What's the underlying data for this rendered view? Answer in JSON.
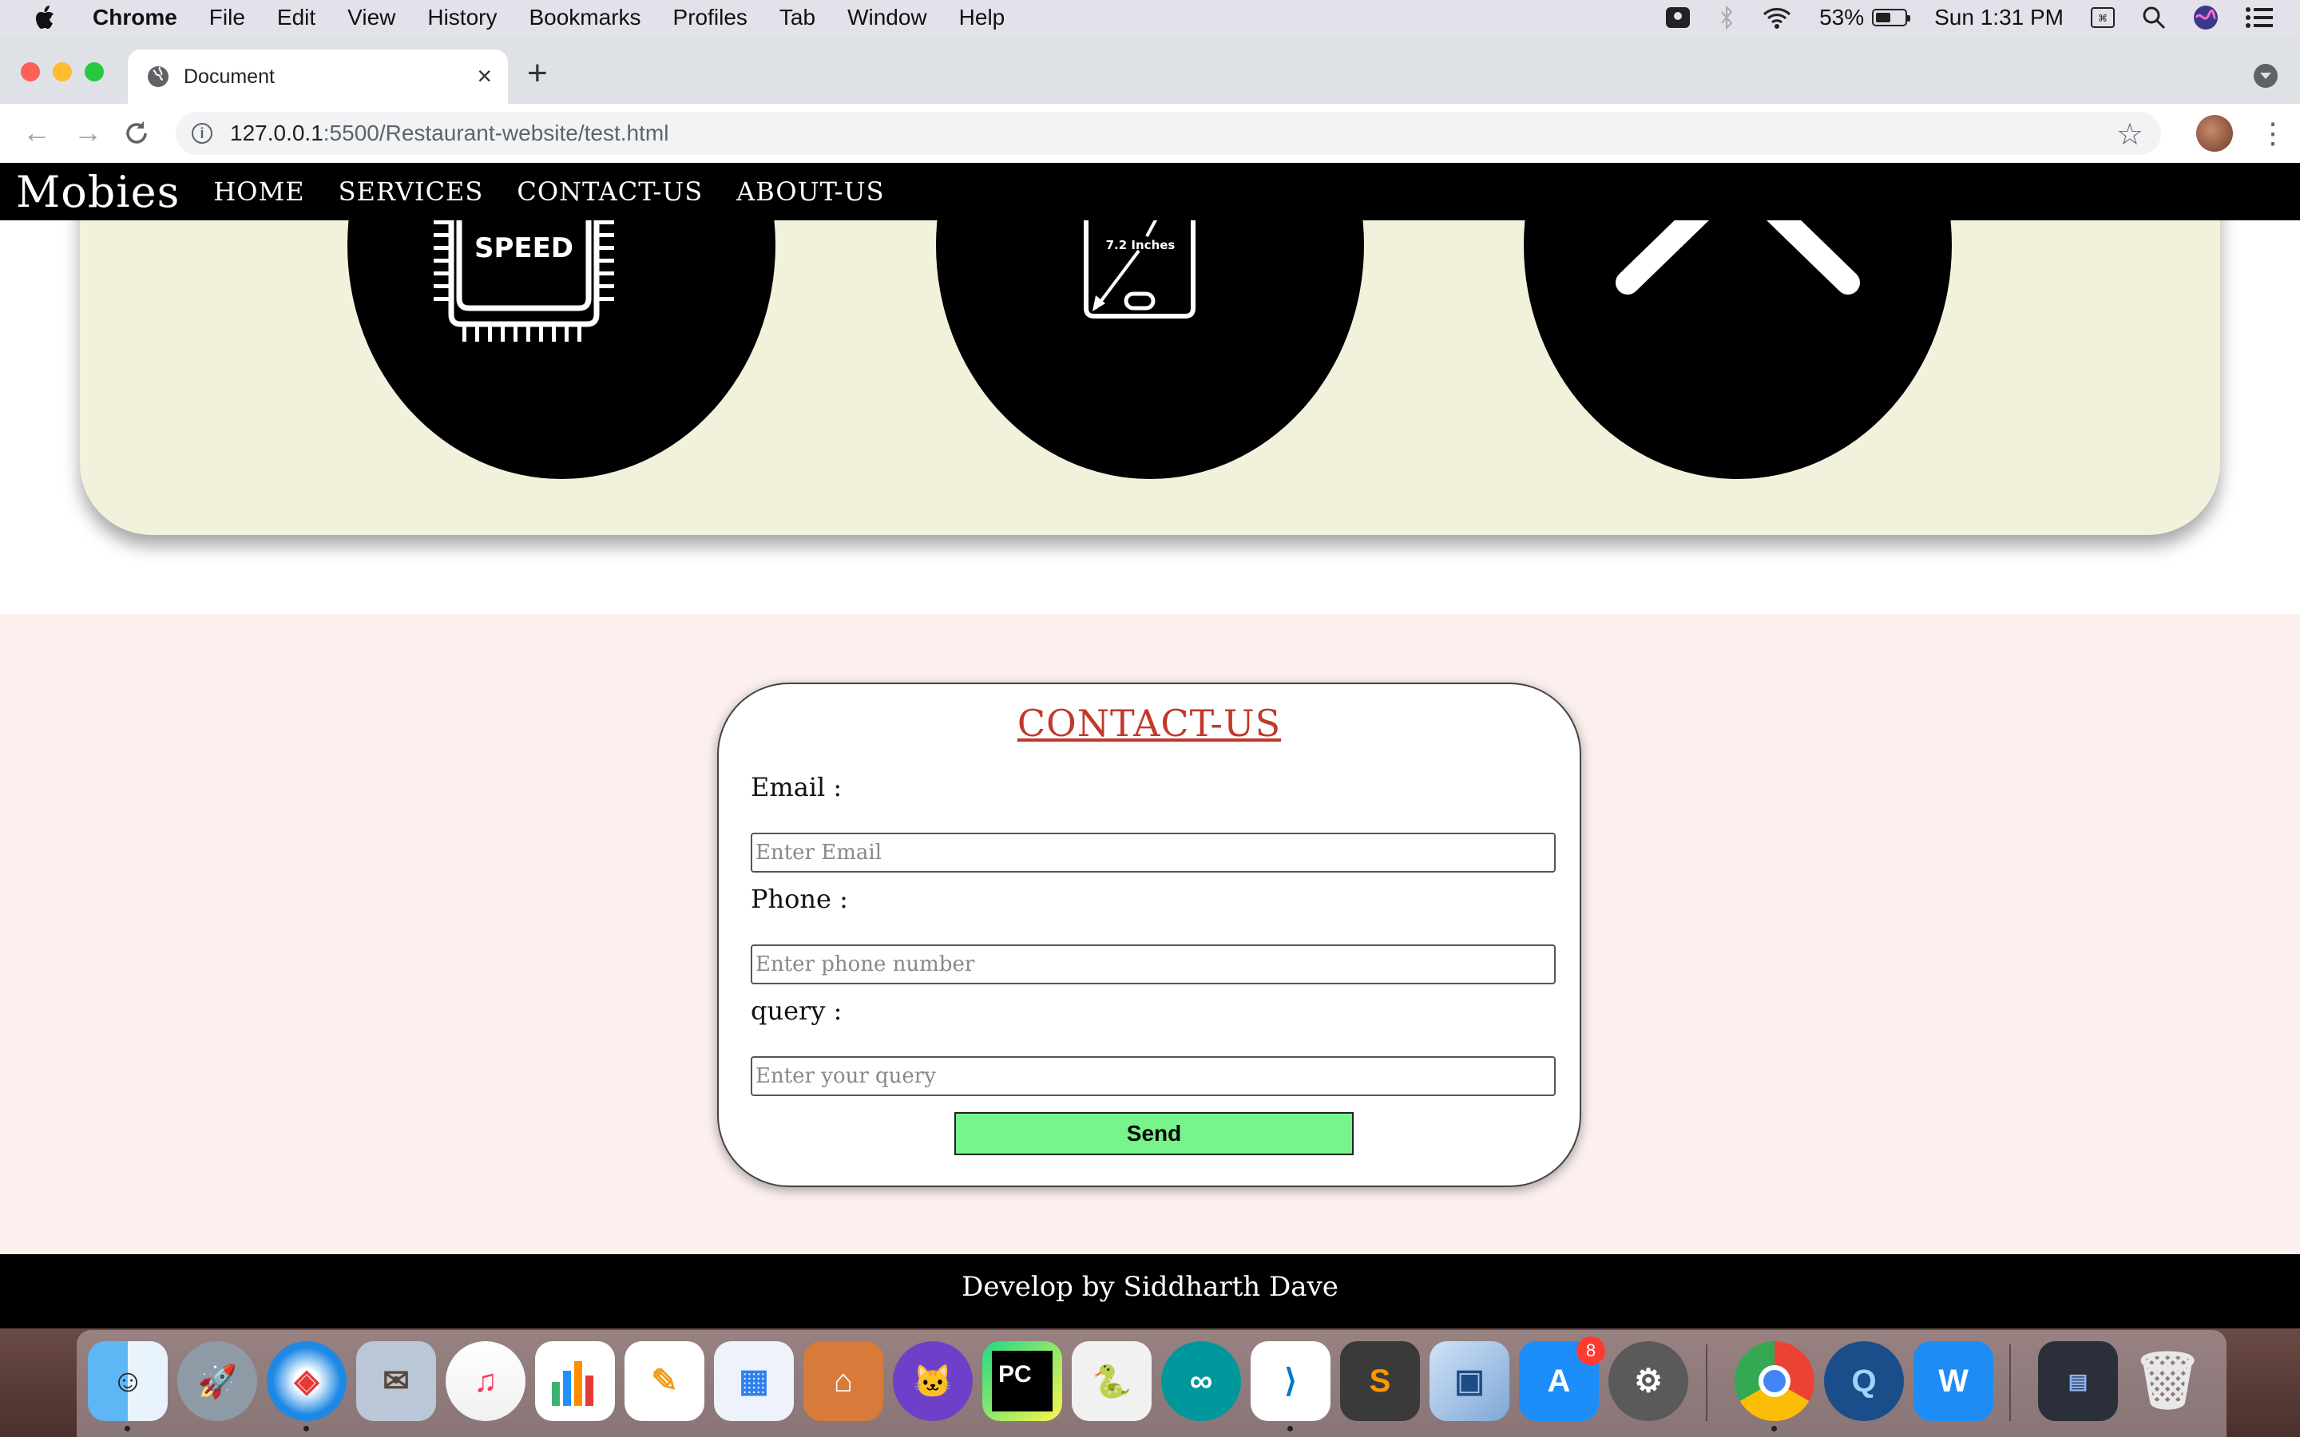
{
  "menubar": {
    "app": "Chrome",
    "items": [
      "File",
      "Edit",
      "View",
      "History",
      "Bookmarks",
      "Profiles",
      "Tab",
      "Window",
      "Help"
    ],
    "battery": "53%",
    "battery_level": 0.53,
    "clock": "Sun 1:31 PM"
  },
  "browser": {
    "tab_title": "Document",
    "url_host": "127.0.0.1",
    "url_path": ":5500/Restaurant-website/test.html"
  },
  "site": {
    "brand": "Mobies",
    "nav": [
      "HOME",
      "SERVICES",
      "CONTACT-US",
      "ABOUT-US"
    ],
    "features": {
      "speed_label": "SPEED",
      "screen_label": "7.2 Inches"
    },
    "contact": {
      "heading": "CONTACT-US",
      "email_label": "Email :",
      "email_placeholder": "Enter Email",
      "phone_label": "Phone :",
      "phone_placeholder": "Enter phone number",
      "query_label": "query :",
      "query_placeholder": "Enter your query",
      "send_label": "Send"
    },
    "footer": "Develop by Siddharth Dave"
  },
  "dock": {
    "apps": [
      "finder",
      "launchpad",
      "safari",
      "mail",
      "music",
      "numbers",
      "pages",
      "keynote",
      "xampp",
      "github-desktop",
      "pycharm",
      "python",
      "arduino",
      "vscode",
      "sublime-text",
      "virtualbox",
      "app-store",
      "system-preferences",
      "chrome",
      "quicktime",
      "wps-office",
      "screenshot",
      "trash"
    ],
    "app_store_badge": "8",
    "pycharm_label": "PC"
  },
  "colors": {
    "contact_heading": "#c0392b",
    "send_button": "#77f58c",
    "features_bg": "#f2f2dc",
    "contact_bg": "#fcf0ee"
  }
}
